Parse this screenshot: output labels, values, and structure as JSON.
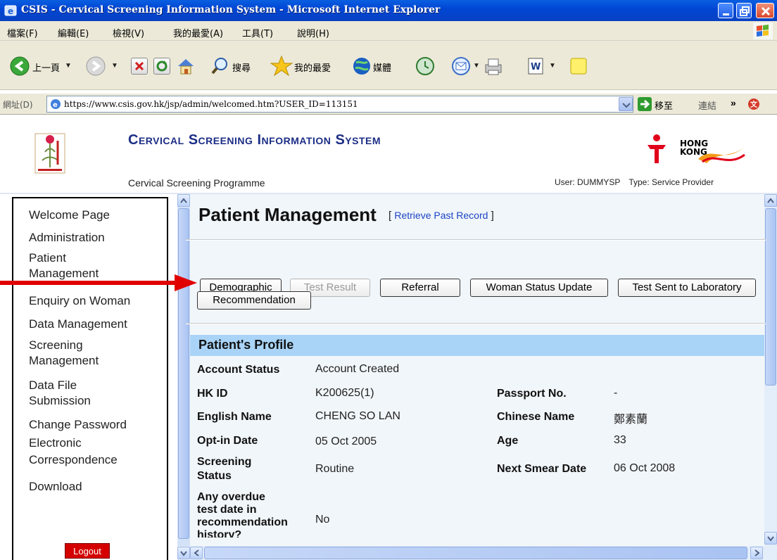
{
  "window": {
    "title": "CSIS - Cervical Screening Information System - Microsoft Internet Explorer"
  },
  "menu": [
    "檔案(F)",
    "編輯(E)",
    "檢視(V)",
    "我的最愛(A)",
    "工具(T)",
    "說明(H)"
  ],
  "toolbar": {
    "back_label": "上一頁",
    "search_label": "搜尋",
    "favorites_label": "我的最愛",
    "media_label": "媒體"
  },
  "addressbar": {
    "label": "網址(D)",
    "url": "https://www.csis.gov.hk/jsp/admin/welcomed.htm?USER_ID=113151",
    "go_label": "移至",
    "links_label": "連結"
  },
  "header": {
    "system_title": "Cervical Screening Information System",
    "programme": "Cervical Screening Programme",
    "user": "User: DUMMYSP",
    "type": "Type: Service Provider",
    "hk_logo_text_1": "HONG",
    "hk_logo_text_2": "KONG"
  },
  "nav": {
    "items": [
      "Welcome Page",
      "Administration",
      "Patient\nManagement",
      "Enquiry on Woman",
      "Data Management",
      "Screening\nManagement",
      "Data File\nSubmission",
      "Change Password",
      "Electronic\nCorrespondence",
      "Download"
    ],
    "logout": "Logout"
  },
  "content": {
    "page_title": "Patient Management",
    "bracket_open": "[",
    "retrieve_link": "Retrieve Past Record",
    "bracket_close": "]",
    "buttons": {
      "demographic": "Demographic",
      "test_result": "Test Result",
      "referral": "Referral",
      "woman_status_update": "Woman Status Update",
      "test_sent": "Test Sent to Laboratory",
      "recommendation": "Recommendation"
    },
    "profile": {
      "heading": "Patient's Profile",
      "account_status_label": "Account Status",
      "account_status": "Account Created",
      "hkid_label": "HK ID",
      "hkid": "K200625(1)",
      "passport_label": "Passport No.",
      "passport": "-",
      "english_name_label": "English Name",
      "english_name": "CHENG SO LAN",
      "chinese_name_label": "Chinese Name",
      "chinese_name": "鄭素蘭",
      "optin_label": "Opt-in Date",
      "optin": "05 Oct 2005",
      "age_label": "Age",
      "age": "33",
      "screening_status_label_1": "Screening",
      "screening_status_label_2": "Status",
      "screening_status": "Routine",
      "next_smear_label": "Next Smear Date",
      "next_smear": "06 Oct 2008",
      "overdue_label_1": "Any overdue",
      "overdue_label_2": "test date in",
      "overdue_label_3": "recommendation",
      "overdue_label_4": "history?",
      "overdue": "No"
    }
  },
  "colors": {
    "title_bar": "#0046d5",
    "chrome": "#ece9d8",
    "system_title": "#1c2e86",
    "content_bg": "#f1f6fa",
    "profile_head": "#a9d4f7",
    "arrow": "#e00000",
    "logout": "#d40000"
  }
}
